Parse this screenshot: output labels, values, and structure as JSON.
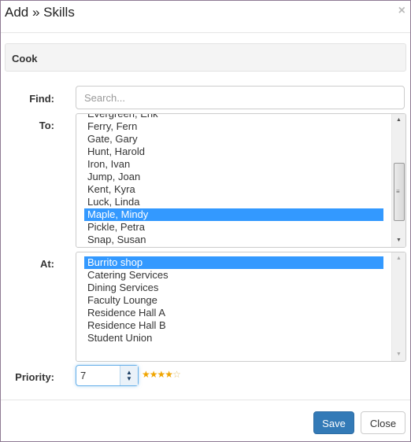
{
  "dialog": {
    "title": "Add » Skills",
    "close_icon": "×"
  },
  "skill": {
    "name": "Cook"
  },
  "form": {
    "find_label": "Find:",
    "search_placeholder": "Search...",
    "search_value": "",
    "to_label": "To:",
    "to_options": [
      {
        "label": "Evergreen, Erik",
        "selected": false
      },
      {
        "label": "Ferry, Fern",
        "selected": false
      },
      {
        "label": "Gate, Gary",
        "selected": false
      },
      {
        "label": "Hunt, Harold",
        "selected": false
      },
      {
        "label": "Iron, Ivan",
        "selected": false
      },
      {
        "label": "Jump, Joan",
        "selected": false
      },
      {
        "label": "Kent, Kyra",
        "selected": false
      },
      {
        "label": "Luck, Linda",
        "selected": false
      },
      {
        "label": "Maple, Mindy",
        "selected": true
      },
      {
        "label": "Pickle, Petra",
        "selected": false
      },
      {
        "label": "Snap, Susan",
        "selected": false
      }
    ],
    "at_label": "At:",
    "at_options": [
      {
        "label": "Burrito shop",
        "selected": true
      },
      {
        "label": "Catering Services",
        "selected": false
      },
      {
        "label": "Dining Services",
        "selected": false
      },
      {
        "label": "Faculty Lounge",
        "selected": false
      },
      {
        "label": "Residence Hall A",
        "selected": false
      },
      {
        "label": "Residence Hall B",
        "selected": false
      },
      {
        "label": "Student Union",
        "selected": false
      }
    ],
    "priority_label": "Priority:",
    "priority_value": "7",
    "rating": {
      "filled": 4,
      "total": 5
    },
    "colors": {
      "selection": "#3399ff",
      "rating_star": "#f0a500",
      "primary": "#337ab7"
    }
  },
  "footer": {
    "save_label": "Save",
    "close_label": "Close"
  }
}
